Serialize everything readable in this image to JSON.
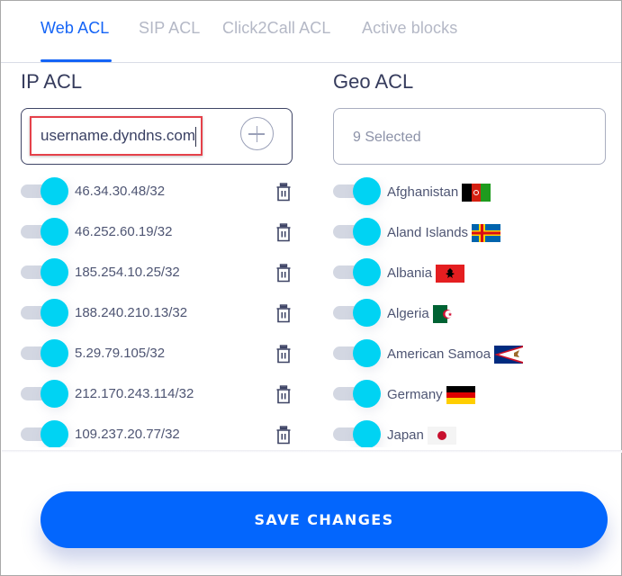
{
  "tabs": [
    {
      "label": "Web ACL",
      "active": true
    },
    {
      "label": "SIP ACL",
      "active": false
    },
    {
      "label": "Click2Call ACL",
      "active": false
    },
    {
      "label": "Active blocks",
      "active": false
    }
  ],
  "ip_acl": {
    "title": "IP ACL",
    "input_value": "username.dyndns.com",
    "add_icon": "plus-circle-icon",
    "entries": [
      {
        "address": "46.34.30.48/32",
        "enabled": true
      },
      {
        "address": "46.252.60.19/32",
        "enabled": true
      },
      {
        "address": "185.254.10.25/32",
        "enabled": true
      },
      {
        "address": "188.240.210.13/32",
        "enabled": true
      },
      {
        "address": "5.29.79.105/32",
        "enabled": true
      },
      {
        "address": "212.170.243.114/32",
        "enabled": true
      },
      {
        "address": "109.237.20.77/32",
        "enabled": true
      }
    ],
    "delete_icon": "trash-icon"
  },
  "geo_acl": {
    "title": "Geo ACL",
    "select_text": "9 Selected",
    "countries": [
      {
        "name": "Afghanistan",
        "flag": "afghanistan-flag",
        "enabled": true
      },
      {
        "name": "Aland Islands",
        "flag": "aland-islands-flag",
        "enabled": true
      },
      {
        "name": "Albania",
        "flag": "albania-flag",
        "enabled": true
      },
      {
        "name": "Algeria",
        "flag": "algeria-flag",
        "enabled": true
      },
      {
        "name": "American Samoa",
        "flag": "american-samoa-flag",
        "enabled": true
      },
      {
        "name": "Germany",
        "flag": "germany-flag",
        "enabled": true
      },
      {
        "name": "Japan",
        "flag": "japan-flag",
        "enabled": true
      }
    ]
  },
  "footer": {
    "save_label": "SAVE CHANGES"
  },
  "colors": {
    "accent": "#1464f6",
    "button": "#0366fd",
    "toggle_knob": "#00d3f3",
    "highlight": "#e5414a"
  }
}
